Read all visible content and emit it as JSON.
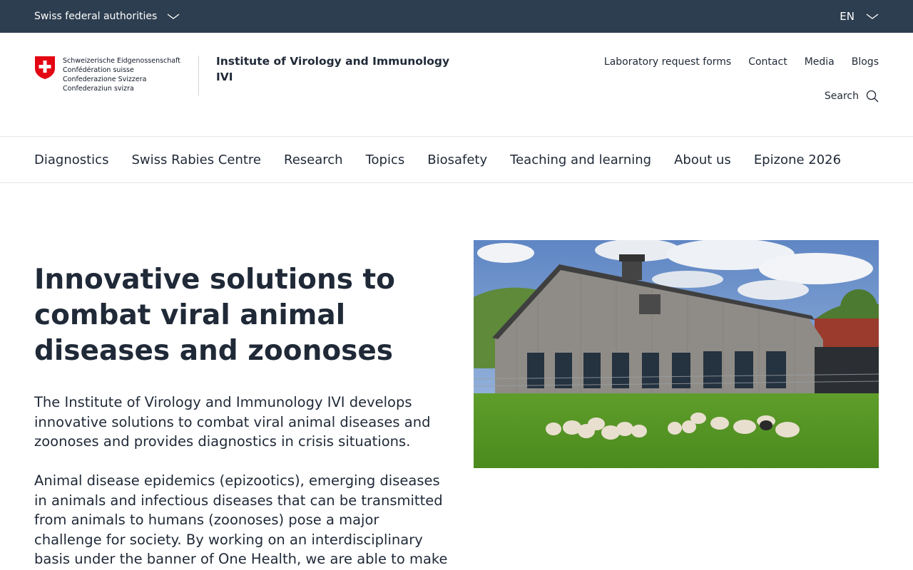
{
  "topbar": {
    "federal_label": "Swiss federal authorities",
    "language": "EN"
  },
  "logo": {
    "lines": [
      "Schweizerische Eidgenossenschaft",
      "Confédération suisse",
      "Confederazione Svizzera",
      "Confederaziun svizra"
    ]
  },
  "header": {
    "institute_name": "Institute of Virology and Immunology IVI",
    "service_links": [
      "Laboratory request forms",
      "Contact",
      "Media",
      "Blogs"
    ],
    "search_label": "Search"
  },
  "nav": {
    "items": [
      "Diagnostics",
      "Swiss Rabies Centre",
      "Research",
      "Topics",
      "Biosafety",
      "Teaching and learning",
      "About us",
      "Epizone 2026"
    ]
  },
  "hero": {
    "title": "Innovative solutions to combat viral animal diseases and zoonoses",
    "lead": "The Institute of Virology and Immunology IVI develops innovative solutions to combat viral animal diseases and zoonoses and provides diagnostics in crisis situations.",
    "paragraph": "Animal disease epidemics (epizootics), emerging diseases in animals and infectious diseases that can be transmitted from animals to humans (zoonoses) pose a major challenge for society. By working on an interdisciplinary basis under the banner of One Health, we are able to make a"
  },
  "colors": {
    "topbar_bg": "#2d3e50",
    "text": "#1f2937",
    "swiss_red": "#e30613"
  }
}
